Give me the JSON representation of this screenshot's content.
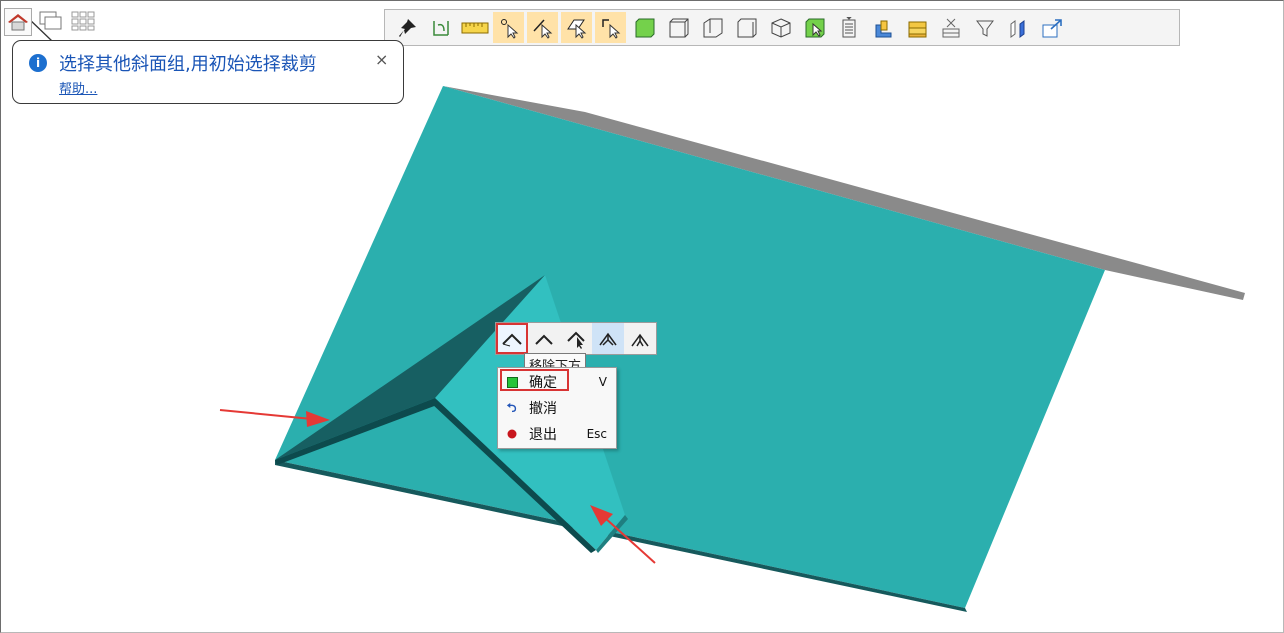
{
  "balloon": {
    "message": "选择其他斜面组,用初始选择裁剪",
    "help_link": "帮助...",
    "close_label": "×"
  },
  "top_left_icons": [
    "home-roof-icon",
    "window-cascade-icon",
    "grid-icon"
  ],
  "toolbar": {
    "buttons": [
      "pin-icon",
      "axis-rotate-icon",
      "ruler-icon",
      "select-point-icon",
      "select-edge-icon",
      "select-face-icon",
      "select-corner-icon",
      "box-front-icon",
      "box-wire-icon",
      "box-left-icon",
      "box-right-icon",
      "box-iso-icon",
      "box-select-icon",
      "list-icon",
      "layers-icon",
      "folder-stack-icon",
      "clear-stack-icon",
      "filter-icon",
      "walls-icon",
      "export-icon"
    ],
    "active_indices": [
      3,
      4,
      5,
      6
    ]
  },
  "mini_toolbar": {
    "buttons": [
      "trim-roof-icon",
      "roof-peak-icon",
      "roof-select-icon",
      "roof-split-icon",
      "roof-join-icon"
    ],
    "selected_index": 0,
    "hover_index": 3,
    "tooltip": "移除下方"
  },
  "context_menu": {
    "items": [
      {
        "label": "确定",
        "shortcut": "V",
        "icon": "confirm-green-icon"
      },
      {
        "label": "撤消",
        "shortcut": "",
        "icon": "undo-arrow-icon"
      },
      {
        "label": "退出",
        "shortcut": "Esc",
        "icon": "exit-red-dot-icon"
      }
    ]
  },
  "colors": {
    "roof_main": "#2aaeae",
    "roof_light": "#31c2c2",
    "roof_dark": "#165c5e",
    "roof_edge": "#0f4f52",
    "roof_grey_edge": "#8c8c8c",
    "arrow_red": "#e53935",
    "highlight_red": "#d83434",
    "info_blue": "#1a55b6",
    "toolbar_active": "#ffe2a8"
  }
}
